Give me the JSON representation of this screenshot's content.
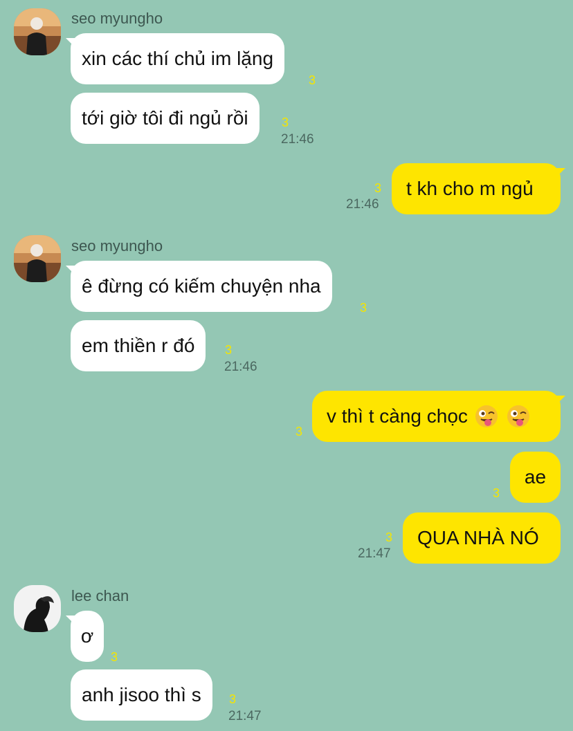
{
  "colors": {
    "background": "#94c7b4",
    "incoming_bubble": "#ffffff",
    "outgoing_bubble": "#fee500",
    "unread_count": "#f5e500"
  },
  "group1": {
    "sender": "seo myungho",
    "m1": {
      "text": "xin các thí chủ im lặng",
      "count": "3"
    },
    "m2": {
      "text": "tới giờ tôi đi ngủ rồi",
      "count": "3",
      "time": "21:46"
    }
  },
  "out1": {
    "text": "t kh cho m ngủ",
    "count": "3",
    "time": "21:46"
  },
  "group2": {
    "sender": "seo myungho",
    "m1": {
      "text": "ê đừng có kiếm chuyện nha",
      "count": "3"
    },
    "m2": {
      "text": "em thiền r đó",
      "count": "3",
      "time": "21:46"
    }
  },
  "out2": {
    "m1": {
      "text": "v thì t càng chọc",
      "emoji": "winking-tongue-emoji",
      "count": "3"
    },
    "m2": {
      "text": "ae",
      "count": "3"
    },
    "m3": {
      "text": "QUA NHÀ NÓ",
      "count": "3",
      "time": "21:47"
    }
  },
  "group3": {
    "sender": "lee chan",
    "m1": {
      "text": "ơ",
      "count": "3"
    },
    "m2": {
      "text": "anh jisoo thì s",
      "count": "3",
      "time": "21:47"
    }
  }
}
